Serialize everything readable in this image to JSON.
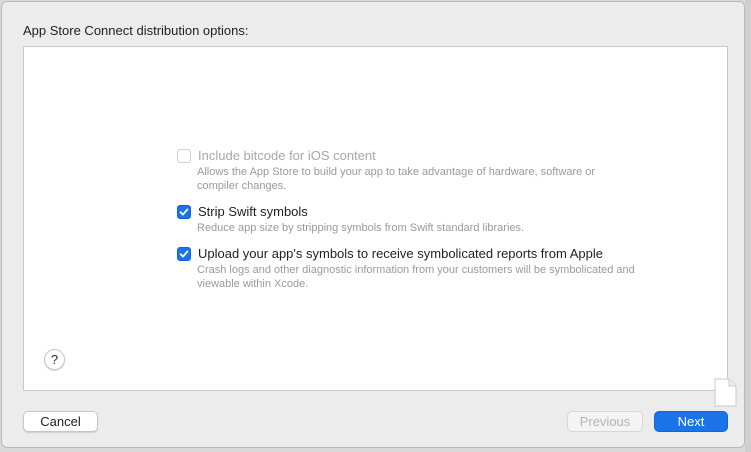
{
  "dialog": {
    "heading": "App Store Connect distribution options:"
  },
  "options": [
    {
      "label": "Include bitcode for iOS content",
      "description": "Allows the App Store to build your app to take advantage of hardware, software or compiler changes.",
      "checked": false,
      "enabled": false
    },
    {
      "label": "Strip Swift symbols",
      "description": "Reduce app size by stripping symbols from Swift standard libraries.",
      "checked": true,
      "enabled": true
    },
    {
      "label": "Upload your app's symbols to receive symbolicated reports from Apple",
      "description": "Crash logs and other diagnostic information from your customers will be symbolicated and viewable within Xcode.",
      "checked": true,
      "enabled": true
    }
  ],
  "help": {
    "label": "?"
  },
  "buttons": {
    "cancel": "Cancel",
    "previous": "Previous",
    "next": "Next"
  },
  "colors": {
    "accent": "#1a73e8",
    "background": "#ececec",
    "panel": "#ffffff"
  },
  "icons": {
    "checkmark": "checkmark-icon",
    "document": "document-icon"
  }
}
